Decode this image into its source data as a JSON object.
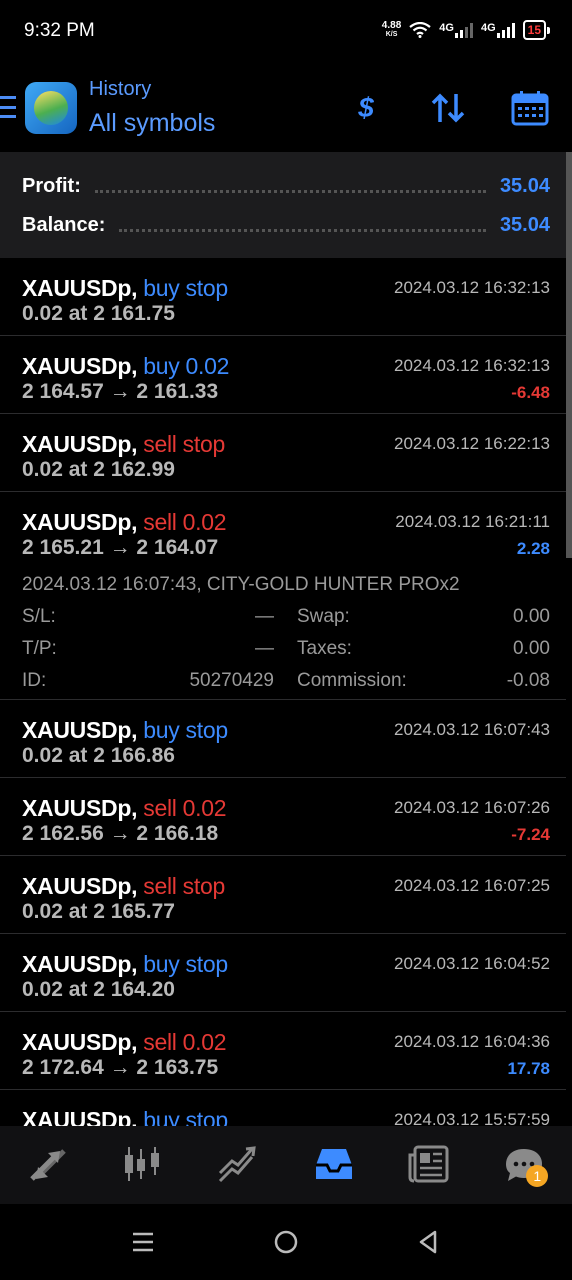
{
  "status_bar": {
    "time": "9:32 PM",
    "speed_value": "4.88",
    "speed_unit": "K/S",
    "net1": "4G",
    "net2": "4G",
    "battery": "15"
  },
  "header": {
    "title": "History",
    "subtitle": "All symbols",
    "dollar_icon": "$"
  },
  "summary": {
    "profit_label": "Profit:",
    "profit_value": "35.04",
    "balance_label": "Balance:",
    "balance_value": "35.04"
  },
  "deals": [
    {
      "symbol": "XAUUSDp,",
      "action": "buy stop",
      "action_color": "blue",
      "detail": "0.02 at 2 161.75",
      "datetime": "2024.03.12 16:32:13",
      "pl": ""
    },
    {
      "symbol": "XAUUSDp,",
      "action": "buy 0.02",
      "action_color": "blue",
      "detail": "2 164.57 → 2 161.33",
      "datetime": "2024.03.12 16:32:13",
      "pl": "-6.48"
    },
    {
      "symbol": "XAUUSDp,",
      "action": "sell stop",
      "action_color": "red",
      "detail": "0.02 at 2 162.99",
      "datetime": "2024.03.12 16:22:13",
      "pl": ""
    },
    {
      "symbol": "XAUUSDp,",
      "action": "sell 0.02",
      "action_color": "red",
      "detail": "2 165.21 → 2 164.07",
      "datetime": "2024.03.12 16:21:11",
      "pl": "2.28"
    },
    {
      "symbol": "XAUUSDp,",
      "action": "buy stop",
      "action_color": "blue",
      "detail": "0.02 at 2 166.86",
      "datetime": "2024.03.12 16:07:43",
      "pl": ""
    },
    {
      "symbol": "XAUUSDp,",
      "action": "sell 0.02",
      "action_color": "red",
      "detail": "2 162.56 → 2 166.18",
      "datetime": "2024.03.12 16:07:26",
      "pl": "-7.24"
    },
    {
      "symbol": "XAUUSDp,",
      "action": "sell stop",
      "action_color": "red",
      "detail": "0.02 at 2 165.77",
      "datetime": "2024.03.12 16:07:25",
      "pl": ""
    },
    {
      "symbol": "XAUUSDp,",
      "action": "buy stop",
      "action_color": "blue",
      "detail": "0.02 at 2 164.20",
      "datetime": "2024.03.12 16:04:52",
      "pl": ""
    },
    {
      "symbol": "XAUUSDp,",
      "action": "sell 0.02",
      "action_color": "red",
      "detail": "2 172.64 → 2 163.75",
      "datetime": "2024.03.12 16:04:36",
      "pl": "17.78"
    },
    {
      "symbol": "XAUUSDp,",
      "action": "buy stop",
      "action_color": "blue",
      "detail": "",
      "datetime": "2024.03.12 15:57:59",
      "pl": ""
    }
  ],
  "expanded_details": {
    "open_info": "2024.03.12 16:07:43, CITY-GOLD HUNTER PROx2",
    "sl_label": "S/L:",
    "sl_value": "—",
    "tp_label": "T/P:",
    "tp_value": "—",
    "id_label": "ID:",
    "id_value": "50270429",
    "swap_label": "Swap:",
    "swap_value": "0.00",
    "taxes_label": "Taxes:",
    "taxes_value": "0.00",
    "commission_label": "Commission:",
    "commission_value": "-0.08"
  },
  "bottom_nav": {
    "items": [
      "quotes-icon",
      "chart-icon",
      "trade-icon",
      "history-icon",
      "news-icon",
      "chat-icon"
    ],
    "active": "history-icon",
    "chat_badge": "1"
  },
  "colors": {
    "accent": "#3d8bff",
    "loss": "#e53935",
    "bg": "#000000",
    "panel": "#1c1c1e"
  }
}
